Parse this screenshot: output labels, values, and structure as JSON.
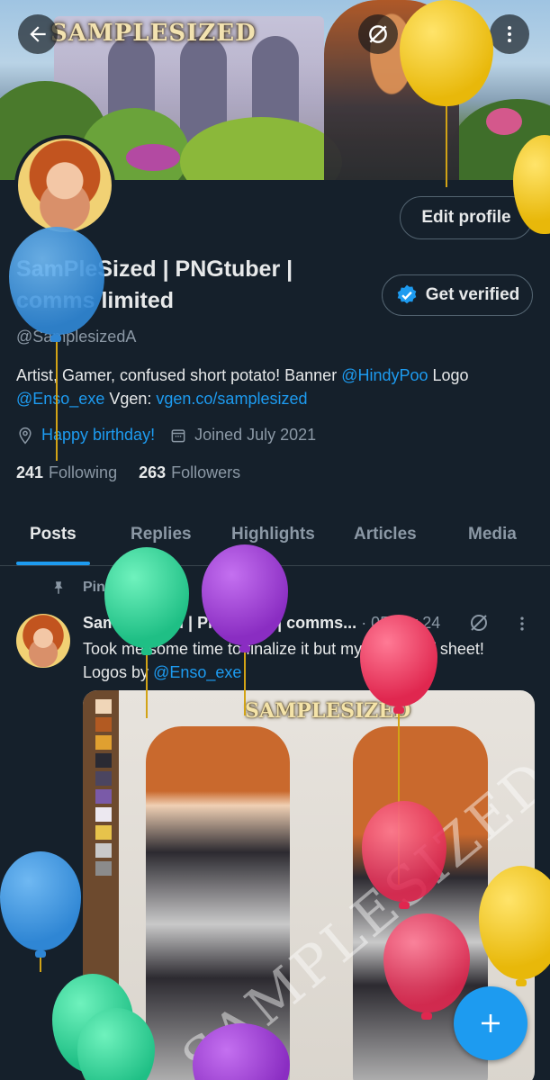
{
  "banner": {
    "logo_text": "SAMPLESIZED"
  },
  "header_buttons": {
    "back": "back-arrow",
    "grok": "grok-icon",
    "search": "search-icon",
    "more": "more-icon"
  },
  "profile": {
    "edit_label": "Edit profile",
    "verify_label": "Get verified",
    "name": "SamPleSized | PNGtuber | comms limited",
    "handle": "@SamplesizedA",
    "bio_text_1": "Artist, Gamer, confused short potato!  Banner ",
    "bio_link_1": "@HindyPoo",
    "bio_text_2": " Logo ",
    "bio_link_2": "@Enso_exe",
    "bio_text_3": "  Vgen: ",
    "bio_link_3": "vgen.co/samplesized",
    "location": "Happy birthday!",
    "joined": "Joined July 2021",
    "following_count": "241",
    "following_label": "Following",
    "followers_count": "263",
    "followers_label": "Followers"
  },
  "tabs": [
    "Posts",
    "Replies",
    "Highlights",
    "Articles",
    "Media"
  ],
  "post": {
    "pinned_label": "Pinned",
    "author": "SamPleSized | PNGtuber | comms...",
    "date": "· 05 Apr 24",
    "text_1": "Took me some time to finalize it but my official ref sheet!",
    "text_2": "Logos by ",
    "text_link": "@Enso_exe",
    "media_logo": "SAMPLESIZED",
    "media_watermark": "SAMPLESIZED"
  },
  "colors": {
    "background": "#15202b",
    "accent": "#1d9bf0",
    "secondary_text": "#8b98a5"
  }
}
